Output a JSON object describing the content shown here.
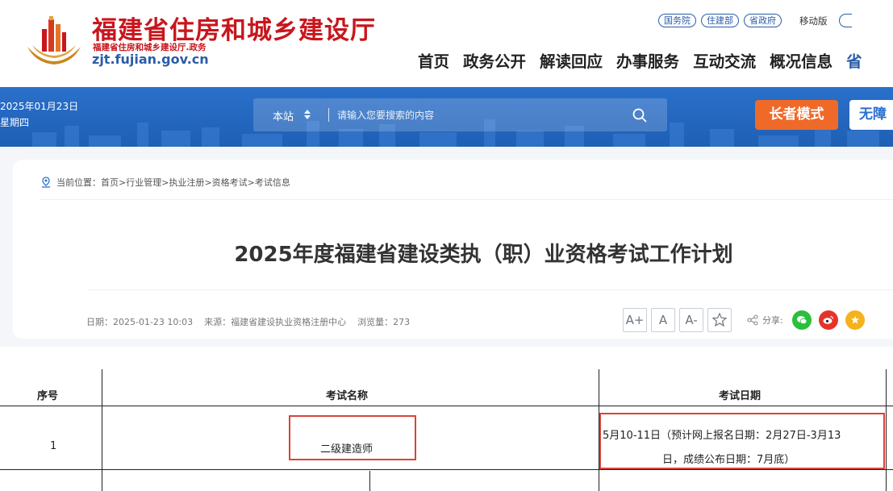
{
  "header": {
    "site_title": "福建省住房和城乡建设厅",
    "site_subtitle": "福建省住房和城乡建设厅.政务",
    "site_domain_prefix": "zjt",
    "site_domain_suffix": ".fujian.gov.cn",
    "top_links": [
      "国务院",
      "住建部",
      "省政府"
    ],
    "mobile_label": "移动版",
    "nav": [
      "首页",
      "政务公开",
      "解读回应",
      "办事服务",
      "互动交流",
      "概况信息",
      "省"
    ]
  },
  "banner": {
    "date": "2025年01月23日",
    "weekday": "星期四",
    "search_scope": "本站",
    "search_placeholder": "请输入您要搜索的内容",
    "elder_mode": "长者模式",
    "barrier_free": "无障"
  },
  "breadcrumb": {
    "prefix": "当前位置：",
    "items": [
      "首页",
      "行业管理",
      "执业注册",
      "资格考试",
      "考试信息"
    ],
    "separator": " > "
  },
  "article": {
    "title": "2025年度福建省建设类执（职）业资格考试工作计划",
    "date": "日期：2025-01-23 10:03",
    "source": "来源：福建省建设执业资格注册中心",
    "views": "浏览量：273"
  },
  "tools": {
    "font_larger": "A+",
    "font_normal": "A",
    "font_smaller": "A-",
    "share_label": "分享:"
  },
  "table": {
    "headers": [
      "序号",
      "考试名称",
      "考试日期"
    ],
    "rows": [
      {
        "index": "1",
        "name": "二级建造师",
        "date_line1": "5月10-11日（预计网上报名日期：2月27日-3月13",
        "date_line2": "日，成绩公布日期：7月底）"
      }
    ]
  },
  "colors": {
    "brand_red": "#c8161d",
    "brand_blue": "#2a5ca8",
    "banner_blue": "#2a70c9",
    "elder_orange": "#ef6a28",
    "highlight_red": "#d9443a"
  }
}
